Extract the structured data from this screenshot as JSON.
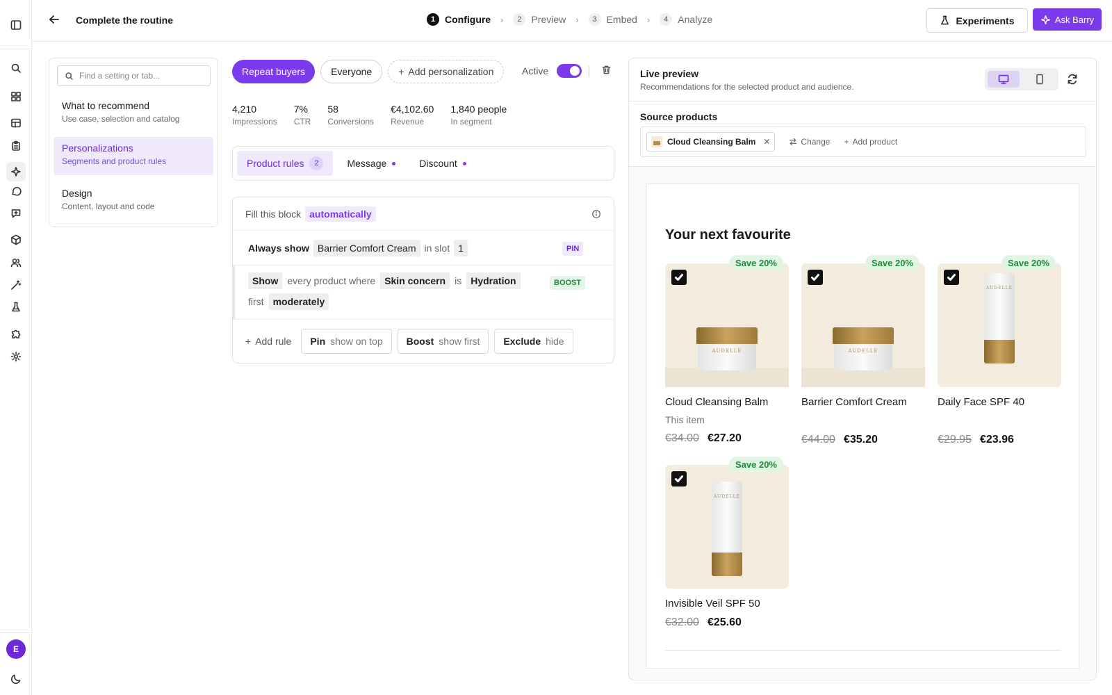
{
  "header": {
    "title": "Complete the routine",
    "steps": [
      {
        "num": "1",
        "label": "Configure"
      },
      {
        "num": "2",
        "label": "Preview"
      },
      {
        "num": "3",
        "label": "Embed"
      },
      {
        "num": "4",
        "label": "Analyze"
      }
    ],
    "experiments_label": "Experiments",
    "ask_label": "Ask Barry"
  },
  "rail": {
    "avatar_initial": "E"
  },
  "settings": {
    "search_placeholder": "Find a setting or tab...",
    "nav": [
      {
        "title": "What to recommend",
        "sub": "Use case, selection and catalog"
      },
      {
        "title": "Personalizations",
        "sub": "Segments and product rules"
      },
      {
        "title": "Design",
        "sub": "Content, layout and code"
      }
    ]
  },
  "personalization": {
    "segments": [
      "Repeat buyers",
      "Everyone"
    ],
    "add_label": "Add personalization",
    "active_label": "Active",
    "active": true,
    "stats": [
      {
        "value": "4,210",
        "label": "Impressions"
      },
      {
        "value": "7%",
        "label": "CTR"
      },
      {
        "value": "58",
        "label": "Conversions"
      },
      {
        "value": "€4,102.60",
        "label": "Revenue"
      },
      {
        "value": "1,840 people",
        "label": "In segment"
      }
    ],
    "tabs": [
      {
        "label": "Product rules",
        "badge": "2"
      },
      {
        "label": "Message"
      },
      {
        "label": "Discount"
      }
    ]
  },
  "rules": {
    "fill_prefix": "Fill this block",
    "fill_mode": "automatically",
    "pin_rule": {
      "lead": "Always show",
      "product": "Barrier Comfort Cream",
      "mid": "in slot",
      "slot": "1",
      "tag": "PIN"
    },
    "boost_rule": {
      "lead": "Show",
      "t1": "every product where",
      "attr": "Skin concern",
      "t2": "is",
      "value": "Hydration",
      "t3": "first",
      "strength": "moderately",
      "tag": "BOOST"
    },
    "add_rule": "Add rule",
    "buttons": [
      {
        "b": "Pin",
        "s": "show on top"
      },
      {
        "b": "Boost",
        "s": "show first"
      },
      {
        "b": "Exclude",
        "s": "hide"
      }
    ]
  },
  "preview": {
    "title": "Live preview",
    "subtitle": "Recommendations for the selected product and audience.",
    "source_title": "Source products",
    "source_product": "Cloud Cleansing Balm",
    "change_label": "Change",
    "add_product_label": "Add product",
    "widget_title": "Your next favourite",
    "brand": "AUDELLE",
    "products": [
      {
        "name": "Cloud Cleansing Balm",
        "sub": "This item",
        "old": "€34.00",
        "new": "€27.20",
        "badge": "Save 20%",
        "checked": true,
        "art": "jar"
      },
      {
        "name": "Barrier Comfort Cream",
        "sub": "",
        "old": "€44.00",
        "new": "€35.20",
        "badge": "Save 20%",
        "checked": true,
        "art": "jar"
      },
      {
        "name": "Daily Face SPF 40",
        "sub": "",
        "old": "€29.95",
        "new": "€23.96",
        "badge": "Save 20%",
        "checked": true,
        "art": "tube"
      },
      {
        "name": "Invisible Veil SPF 50",
        "sub": "",
        "old": "€32.00",
        "new": "€25.60",
        "badge": "Save 20%",
        "checked": true,
        "art": "tube"
      }
    ]
  },
  "colors": {
    "accent": "#7c3aed",
    "accent_bg": "#efe9fb",
    "success": "#1f8a3a"
  }
}
